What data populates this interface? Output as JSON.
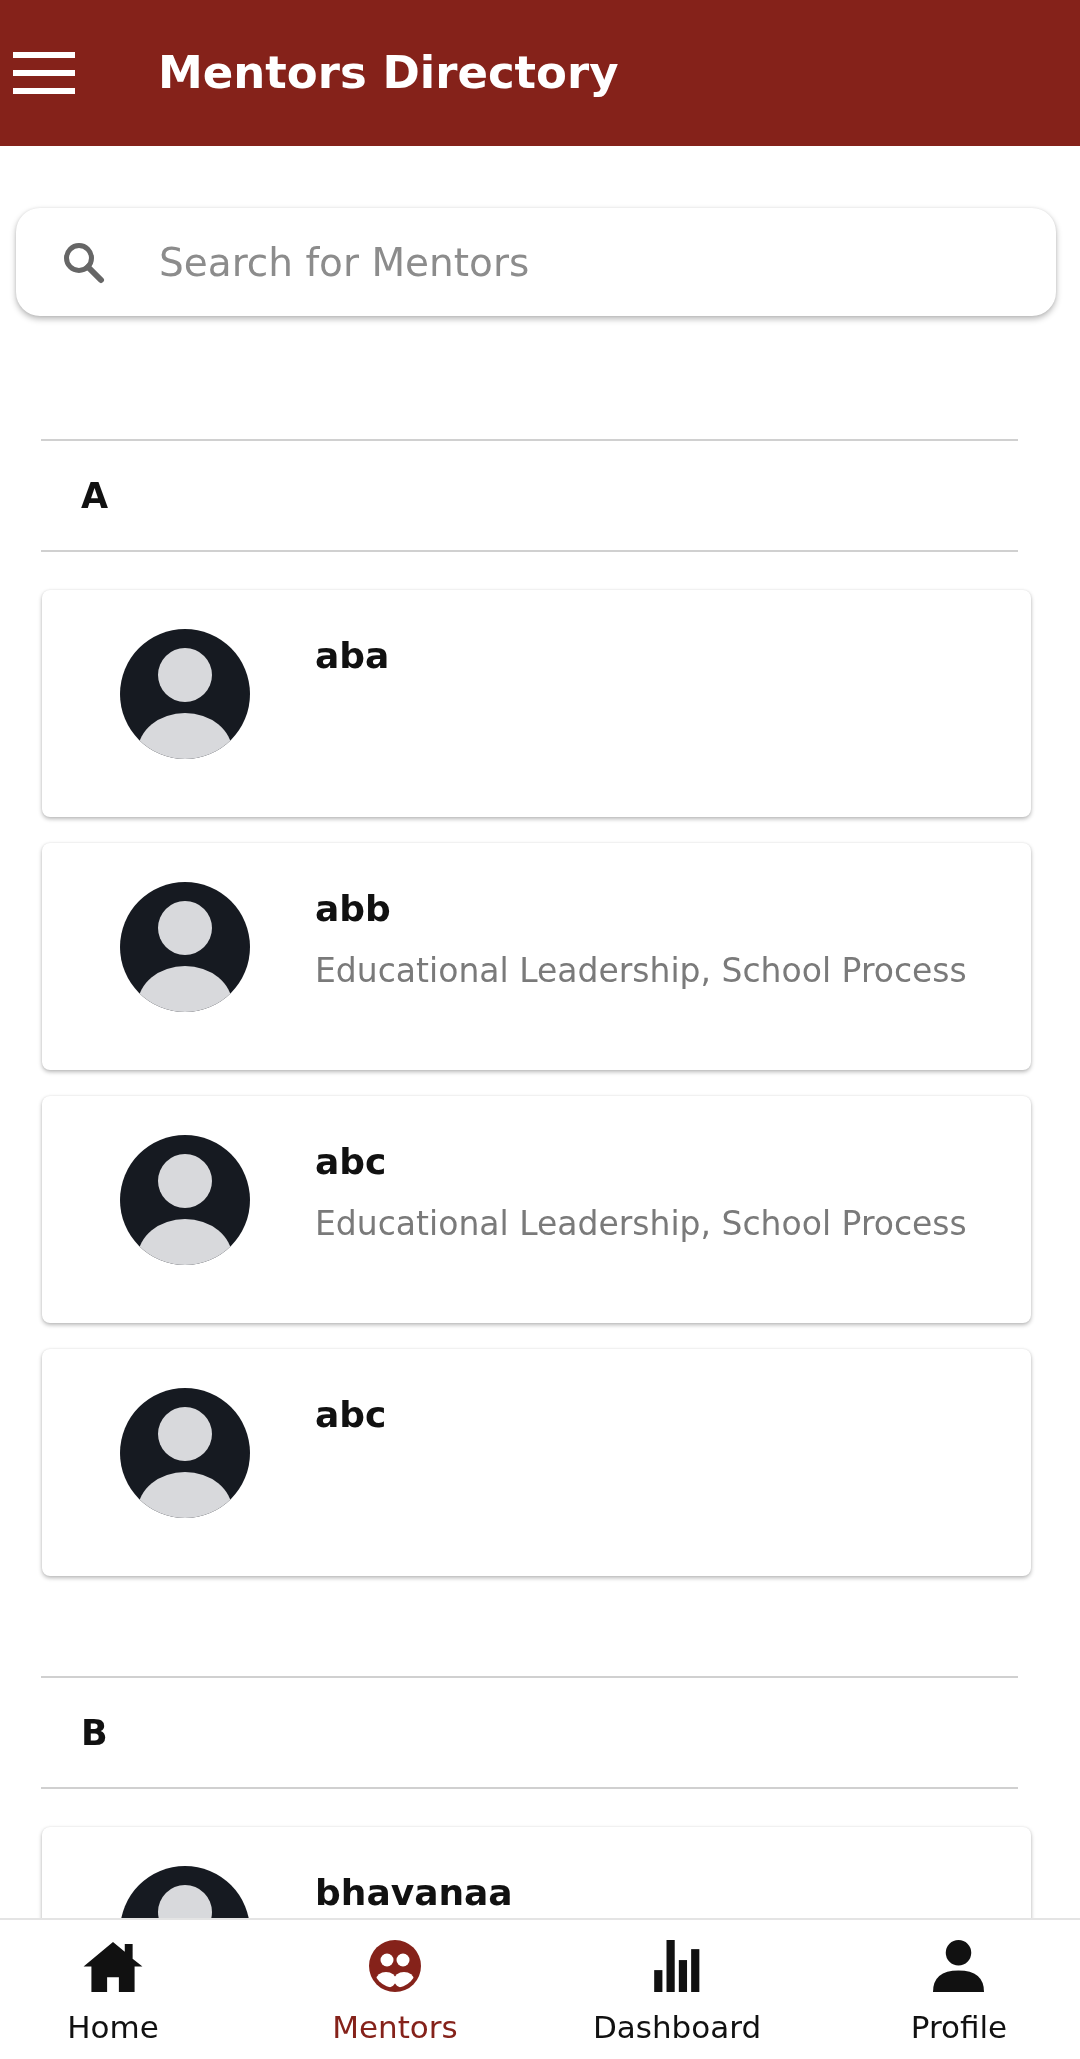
{
  "app_bar": {
    "title": "Mentors Directory"
  },
  "search": {
    "placeholder": "Search for Mentors"
  },
  "sections": [
    {
      "letter": "A",
      "mentors": [
        {
          "name": "aba"
        },
        {
          "name": "abb",
          "expertise": "Educational Leadership, School Process"
        },
        {
          "name": "abc",
          "expertise": "Educational Leadership, School Process"
        },
        {
          "name": "abc"
        }
      ]
    },
    {
      "letter": "B",
      "mentors": [
        {
          "name": "bhavanaa"
        }
      ]
    }
  ],
  "bottom_nav": [
    {
      "kind": "home",
      "label": "Home",
      "selected": false
    },
    {
      "kind": "mentors",
      "label": "Mentors",
      "selected": true
    },
    {
      "kind": "dashboard",
      "label": "Dashboard",
      "selected": false
    },
    {
      "kind": "profile",
      "label": "Profile",
      "selected": false
    }
  ]
}
